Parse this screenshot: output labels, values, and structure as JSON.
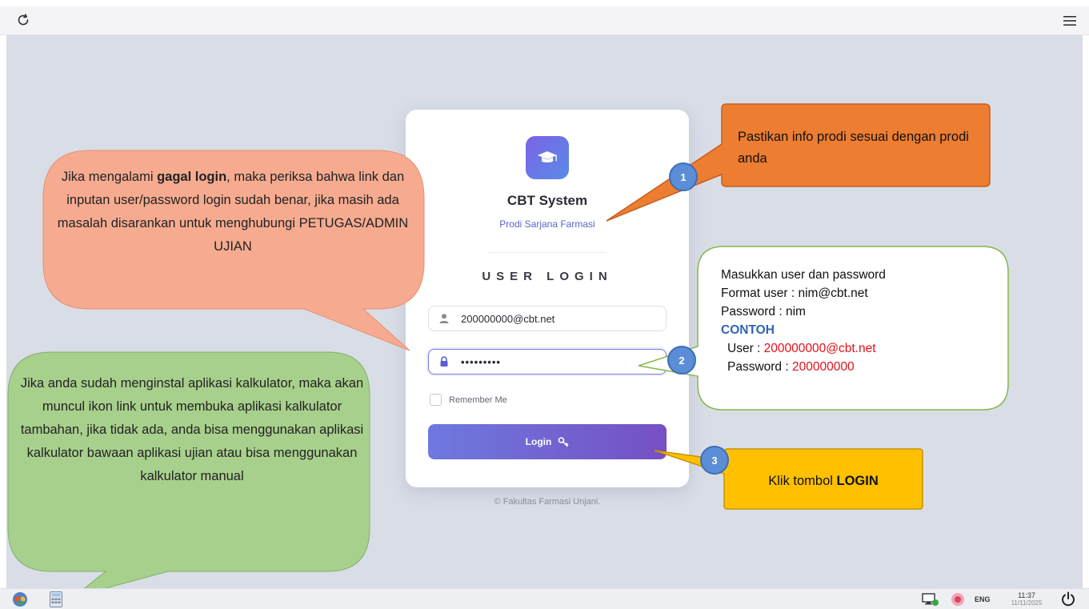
{
  "app": {
    "title": "CBT System",
    "subtitle": "Prodi Sarjana Farmasi",
    "login_heading": "USER LOGIN",
    "username_value": "200000000@cbt.net",
    "password_value": "•••••••••",
    "remember_label": "Remember Me",
    "login_button_label": "Login",
    "footer": "© Fakultas Farmasi Unjani."
  },
  "callouts": {
    "failed_login": {
      "before": "Jika mengalami ",
      "bold": "gagal login",
      "after": ", maka periksa bahwa link dan inputan user/password login sudah benar, jika masih ada masalah disarankan untuk menghubungi PETUGAS/ADMIN UJIAN"
    },
    "calculator": "Jika anda sudah menginstal aplikasi kalkulator, maka akan muncul ikon link untuk membuka aplikasi kalkulator tambahan, jika tidak ada, anda bisa menggunakan aplikasi kalkulator bawaan aplikasi ujian atau bisa menggunakan kalkulator manual",
    "prodi_info": "Pastikan info prodi sesuai dengan prodi anda",
    "credentials": {
      "line1": "Masukkan user dan password",
      "line2": "Format user : nim@cbt.net",
      "line3": "Password : nim",
      "example_label": "CONTOH",
      "example_user_label": "User : ",
      "example_user_value": "200000000@cbt.net",
      "example_pass_label": "Password : ",
      "example_pass_value": "200000000"
    },
    "login_click": {
      "before": "Klik tombol ",
      "bold": "LOGIN"
    }
  },
  "badges": [
    "1",
    "2",
    "3"
  ],
  "taskbar": {
    "language": "ENG",
    "time": "11:37",
    "date": "11/11/2025"
  },
  "icons": {
    "reload": "reload-icon",
    "menu": "hamburger-menu-icon",
    "logo": "graduation-cap-icon",
    "user": "user-icon",
    "lock": "lock-icon",
    "key": "key-icon",
    "start": "start-menu-icon",
    "calculator": "calculator-icon",
    "network": "network-icon",
    "volume": "volume-icon",
    "power": "power-icon"
  },
  "colors": {
    "background": "#d9dde6",
    "accent": "#6e79df",
    "callout_red": "#f6ab90",
    "callout_green": "#a8d08d",
    "callout_orange": "#ed7d31",
    "callout_yellow": "#ffc000",
    "badge": "#5b8ed6"
  }
}
